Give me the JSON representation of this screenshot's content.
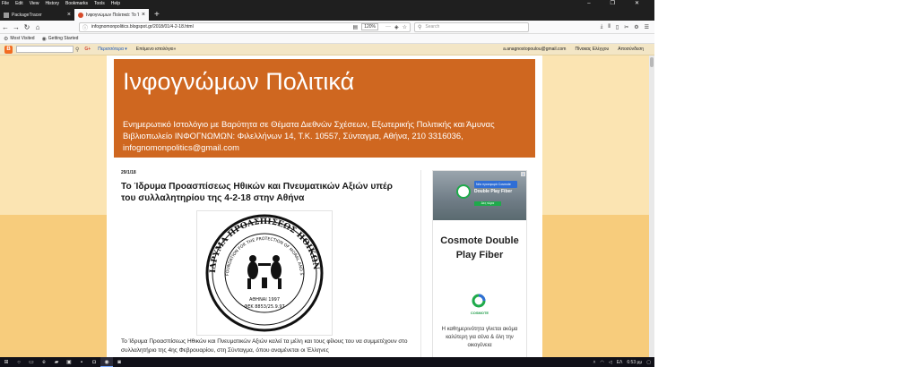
{
  "menu": [
    "File",
    "Edit",
    "View",
    "History",
    "Bookmarks",
    "Tools",
    "Help"
  ],
  "window_controls": {
    "minimize": "–",
    "restore": "❐",
    "close": "✕"
  },
  "tabs": [
    {
      "title": "PackageTracer",
      "active": false
    },
    {
      "title": "Ινφογνώμων Πολιτικά: Το Ίδ",
      "active": true
    }
  ],
  "nav": {
    "url": "infognomonpolitics.blogspot.gr/2018/01/4-2-18.html",
    "zoom": "120%",
    "search_placeholder": "Search"
  },
  "bookmarks": [
    {
      "label": "Most Visited"
    },
    {
      "label": "Getting Started"
    }
  ],
  "blogger_nav": {
    "logo": "B",
    "gplus": "G+",
    "more": "Περισσότερα ▾",
    "next_blog": "Επόμενο ιστολόγιο»",
    "email": "a.anagnostopoulou@gmail.com",
    "dashboard": "Πίνακας Ελέγχου",
    "signout": "Αποσύνδεση"
  },
  "blog": {
    "title": "Ινφογνώμων Πολιτικά",
    "description": "Ενημερωτικό Ιστολόγιο με Βαρύτητα σε Θέματα Διεθνών Σχέσεων, Εξωτερικής Πολιτικής και Άμυνας Βιβλιοπωλείο ΙΝΦΟΓΝΩΜΩΝ: Φιλελλήνων 14, Τ.Κ. 10557, Σύνταγμα, Αθήνα, 210 3316036, infognomonpolitics@gmail.com"
  },
  "post": {
    "date": "29/1/18",
    "title": "Το Ίδρυμα Προασπίσεως Ηθικών και Πνευματικών Αξιών υπέρ του συλλαλητηρίου της 4-2-18 στην Αθήνα",
    "seal_greek_text": "ΙΔΡΥΜΑ ΠΡΟΑΣΠΙΣΕΩΣ ΗΘΙΚΩΝ ΚΑΙ ΠΝΕΥΜΑΤΙΚΩΝ ΑΞΙΩΝ",
    "seal_english_text": "FOUNDATION FOR THE PROTECTION OF MORAL AND SPIRITUAL VALUES",
    "seal_city": "ΑΘΗΝΑΙ 1997",
    "seal_reg": "ΦΕΚ 8853/25.9.97",
    "text": "Το Ίδρυμα Προασπίσεως Ηθικών και Πνευματικών Αξιών καλεί τα μέλη και τους φίλους του να συμμετέχουν στο συλλαλητήριο της 4ης Φεβρουαρίου, στη Σύνταγμα, όπου αναμένεται οι Έλληνες"
  },
  "ad": {
    "banner_line1": "Νέα προσφορά Cosmote",
    "banner_line2": "Double Play Fiber",
    "banner_badge": "Δες τώρα",
    "title": "Cosmote Double Play Fiber",
    "brand": "COSMOTE",
    "description": "Η καθημερινότητα γίνεται ακόμα καλύτερη για σένα & όλη την οικογένεια",
    "info": "i"
  },
  "taskbar": {
    "language": "ΕΛ",
    "time": "6:53 μμ"
  },
  "colors": {
    "header": "#cf6720",
    "page_bg": "#fbe4b2",
    "cosmote_green": "#1faa4b"
  }
}
